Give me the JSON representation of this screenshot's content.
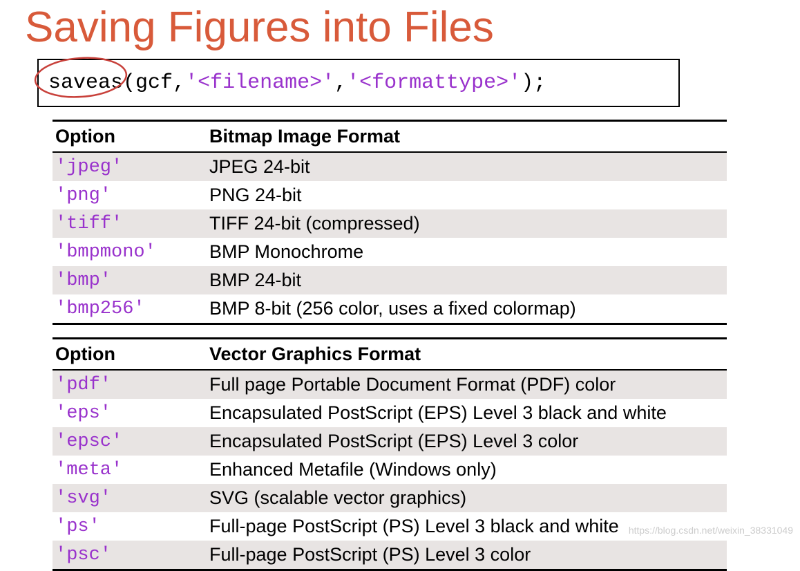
{
  "title": "Saving Figures into Files",
  "code": {
    "fn": "saveas",
    "paren_open": "(",
    "arg1": "gcf",
    "comma1": ",",
    "str1": "'<filename>'",
    "comma2": ",",
    "str2": "'<formattype>'",
    "paren_close": ")",
    "semi": ";"
  },
  "table1": {
    "h1": "Option",
    "h2": "Bitmap Image Format",
    "rows": [
      {
        "opt": "'jpeg'",
        "desc": "JPEG 24-bit"
      },
      {
        "opt": "'png'",
        "desc": "PNG 24-bit"
      },
      {
        "opt": "'tiff'",
        "desc": "TIFF 24-bit (compressed)"
      },
      {
        "opt": "'bmpmono'",
        "desc": "BMP Monochrome"
      },
      {
        "opt": "'bmp'",
        "desc": "BMP 24-bit"
      },
      {
        "opt": "'bmp256'",
        "desc": "BMP 8-bit (256 color, uses a fixed colormap)"
      }
    ]
  },
  "table2": {
    "h1": "Option",
    "h2": "Vector Graphics Format",
    "rows": [
      {
        "opt": "'pdf'",
        "desc": "Full page Portable Document Format (PDF) color"
      },
      {
        "opt": "'eps'",
        "desc": "Encapsulated PostScript (EPS) Level 3 black and white"
      },
      {
        "opt": "'epsc'",
        "desc": "Encapsulated PostScript (EPS) Level 3 color"
      },
      {
        "opt": "'meta'",
        "desc": "Enhanced Metafile (Windows only)"
      },
      {
        "opt": "'svg'",
        "desc": "SVG (scalable vector graphics)"
      },
      {
        "opt": "'ps'",
        "desc": "Full-page PostScript (PS) Level 3 black and white"
      },
      {
        "opt": "'psc'",
        "desc": "Full-page PostScript (PS) Level 3 color"
      }
    ]
  },
  "watermark": "https://blog.csdn.net/weixin_38331049"
}
